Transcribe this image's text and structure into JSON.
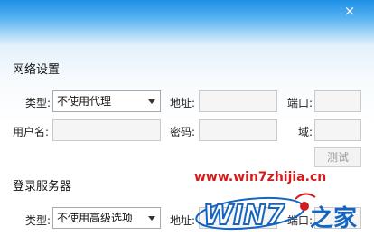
{
  "titlebar": {
    "close_glyph": "×"
  },
  "network": {
    "title": "网络设置",
    "type_label": "类型:",
    "type_value": "不使用代理",
    "address_label": "地址:",
    "port_label": "端口:",
    "username_label": "用户名:",
    "password_label": "密码:",
    "domain_label": "域:",
    "test_button": "测试"
  },
  "login_server": {
    "title": "登录服务器",
    "type_label": "类型:",
    "type_value": "不使用高级选项",
    "address_label": "地址:",
    "port_label": "端口:"
  },
  "watermark": {
    "url": "www.win7zhijia.cn",
    "logo_text": "WIN7",
    "logo_suffix": "之家"
  },
  "colors": {
    "title_blue": "#1e8fe6",
    "watermark_red": "#d41a1a",
    "watermark_blue": "#1565c0"
  }
}
